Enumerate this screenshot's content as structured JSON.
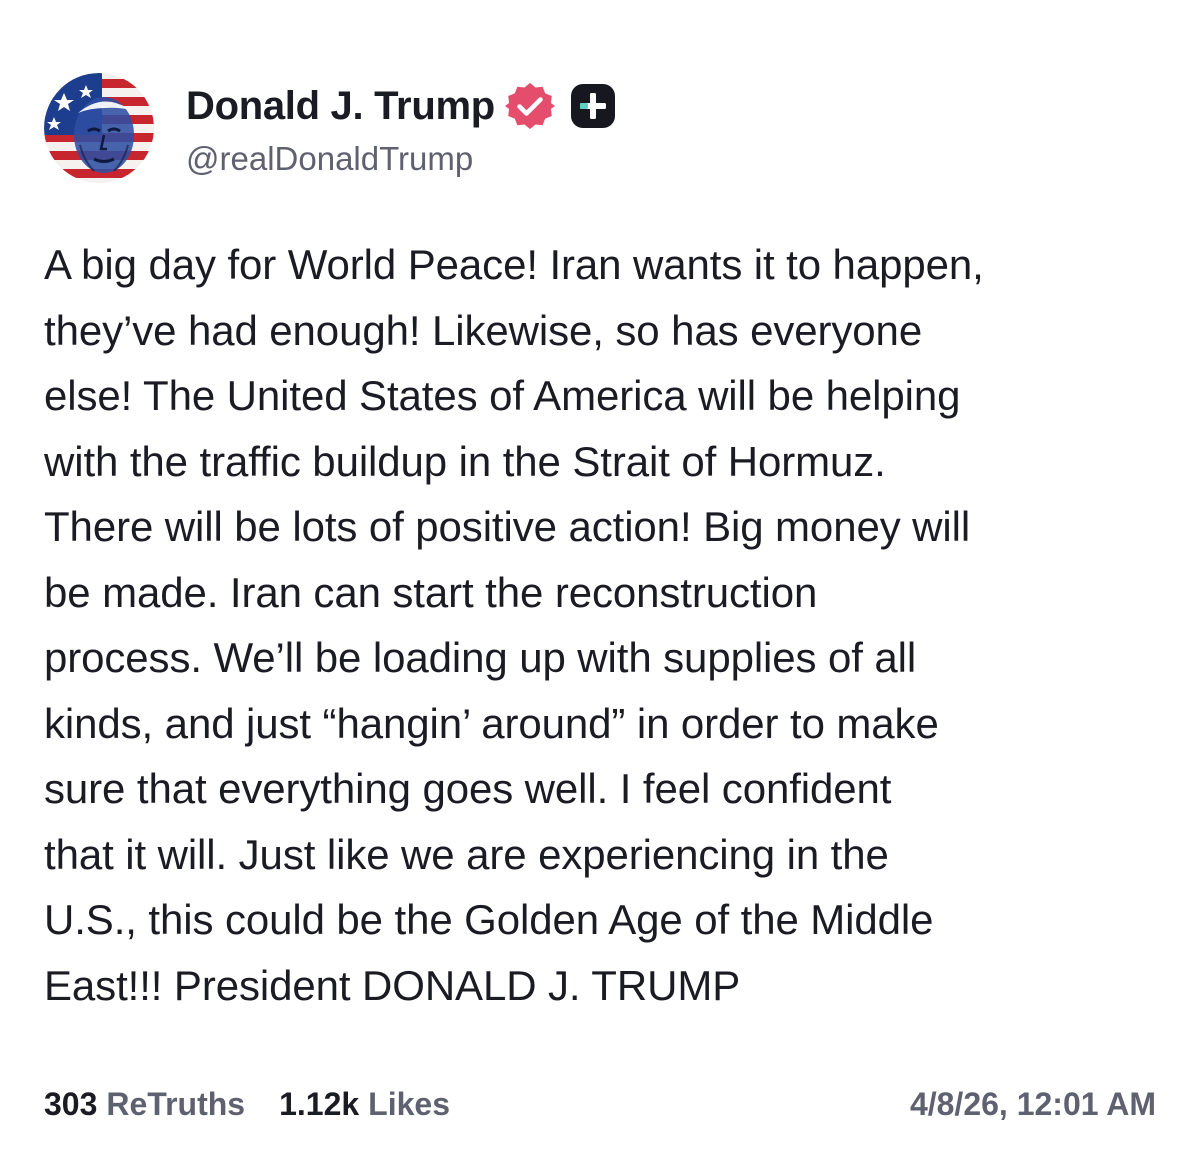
{
  "author": {
    "display_name": "Donald J. Trump",
    "handle": "@realDonaldTrump",
    "avatar_icon": "flag-portrait-avatar",
    "verified_icon": "verified-badge-icon",
    "plus_icon": "truth-plus-badge-icon"
  },
  "post": {
    "text": "A big day for World Peace! Iran wants it to happen,\nthey’ve had enough! Likewise, so has everyone\nelse! The United States of America will be helping\nwith the traffic buildup in the Strait of Hormuz.\nThere will be lots of positive action! Big money will\nbe made. Iran can start the reconstruction\nprocess. We’ll be loading up with supplies of all\nkinds, and just “hangin’ around” in order to make\nsure that everything goes well. I feel confident\nthat it will. Just like we are experiencing in the\nU.S., this could be the Golden Age of the Middle\nEast!!! President DONALD J. TRUMP"
  },
  "stats": {
    "retruths_count": "303",
    "retruths_label": "ReTruths",
    "likes_count": "1.12k",
    "likes_label": "Likes",
    "timestamp": "4/8/26, 12:01 AM"
  },
  "colors": {
    "text_primary": "#1b1b24",
    "text_secondary": "#5f6170",
    "verified_badge": "#e44d6c",
    "plus_badge_bg": "#17171f",
    "plus_badge_accent": "#5ed0c4"
  }
}
